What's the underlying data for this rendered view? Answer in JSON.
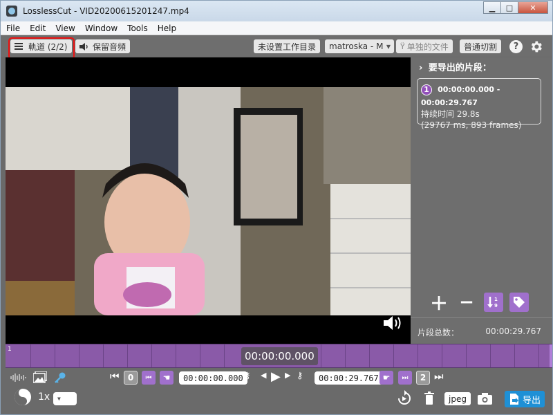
{
  "window": {
    "title": "LosslessCut - VID20200615201247.mp4",
    "minimize": "▁",
    "maximize": "□",
    "close": "✕"
  },
  "menu": [
    "File",
    "Edit",
    "View",
    "Window",
    "Tools",
    "Help"
  ],
  "toolbar": {
    "tracks_label": "軌道 (2/2)",
    "audio_label": "保留音頻",
    "workdir_label": "未设置工作目录",
    "format_label": "matroska - M",
    "separate_files_label": "单独的文件",
    "cut_mode_label": "普通切割",
    "help_icon": "?"
  },
  "right_panel": {
    "header": "要导出的片段：",
    "segment": {
      "number": "1",
      "range": "00:00:00.000 - 00:00:29.767",
      "duration": "持续时间 29.8s",
      "details": "(29767 ms, 893 frames)"
    },
    "total_label": "片段总数：",
    "total_value": "00:00:29.767"
  },
  "timeline": {
    "current_time": "00:00:00.000",
    "segment_marker": "1"
  },
  "bottom": {
    "speed": "1x",
    "start_index": "0",
    "end_index": "2",
    "start_time": "00:00:00.000",
    "end_time": "00:00:29.767",
    "format": "jpeg",
    "export_label": "导出"
  }
}
